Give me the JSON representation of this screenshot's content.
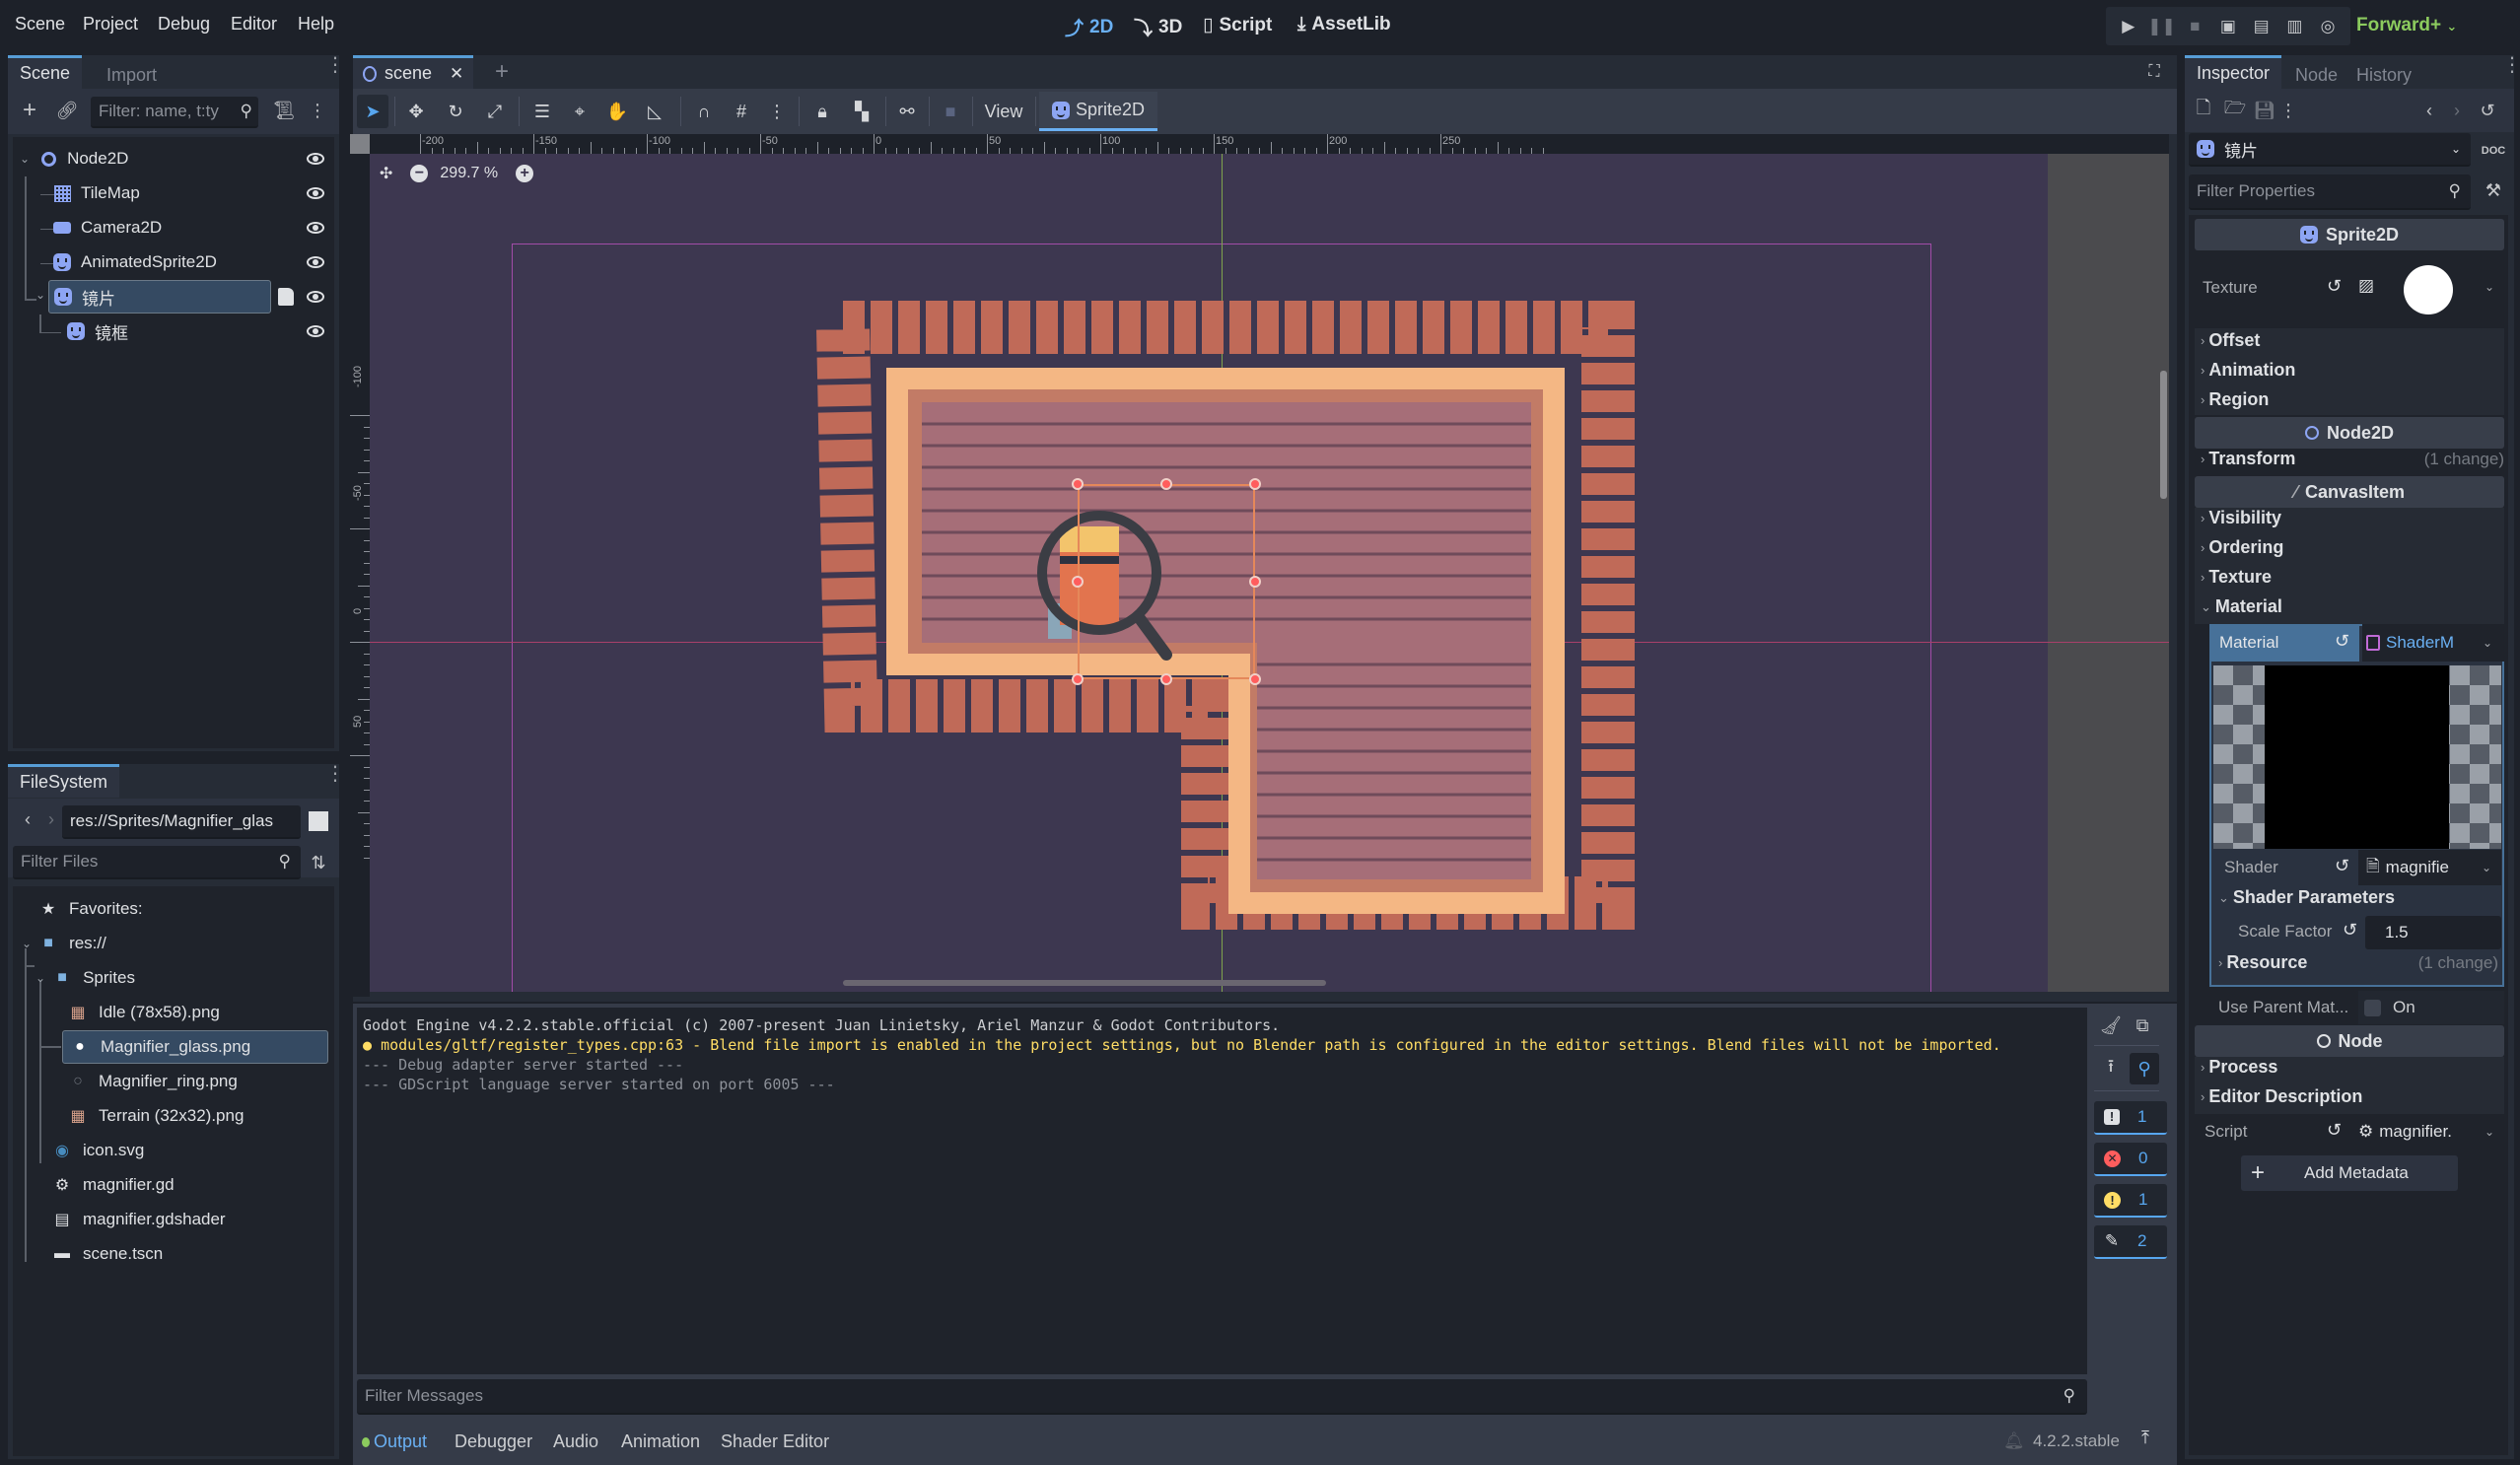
{
  "menu": [
    "Scene",
    "Project",
    "Debug",
    "Editor",
    "Help"
  ],
  "workspaces": [
    {
      "label": "2D",
      "icon": "2d-icon",
      "active": true
    },
    {
      "label": "3D",
      "icon": "3d-icon",
      "active": false
    },
    {
      "label": "Script",
      "icon": "script-icon",
      "active": false
    },
    {
      "label": "AssetLib",
      "icon": "assetlib-icon",
      "active": false
    }
  ],
  "run_bar": [
    "play-icon",
    "pause-icon",
    "stop-icon",
    "remote-debug-icon",
    "play-scene-icon",
    "play-custom-scene-icon",
    "movie-maker-icon"
  ],
  "renderer": "Forward+",
  "scene_dock": {
    "tabs": [
      "Scene",
      "Import"
    ],
    "filter_placeholder": "Filter: name, t:ty",
    "nodes": [
      {
        "name": "Node2D",
        "type": "Node2D",
        "depth": 0
      },
      {
        "name": "TileMap",
        "type": "TileMap",
        "depth": 1
      },
      {
        "name": "Camera2D",
        "type": "Camera2D",
        "depth": 1
      },
      {
        "name": "AnimatedSprite2D",
        "type": "AnimatedSprite2D",
        "depth": 1
      },
      {
        "name": "镜片",
        "type": "Sprite2D",
        "depth": 1,
        "selected": true,
        "has_script": true
      },
      {
        "name": "镜框",
        "type": "Sprite2D",
        "depth": 2
      }
    ]
  },
  "filesystem": {
    "tab": "FileSystem",
    "path": "res://Sprites/Magnifier_glas",
    "filter_placeholder": "Filter Files",
    "items": [
      {
        "label": "Favorites:",
        "icon": "star-icon"
      },
      {
        "label": "res://",
        "icon": "folder-icon"
      },
      {
        "label": "Sprites",
        "icon": "folder-icon"
      },
      {
        "label": "Idle (78x58).png",
        "icon": "image-icon"
      },
      {
        "label": "Magnifier_glass.png",
        "icon": "image-icon",
        "selected": true
      },
      {
        "label": "Magnifier_ring.png",
        "icon": "image-icon"
      },
      {
        "label": "Terrain (32x32).png",
        "icon": "image-icon"
      },
      {
        "label": "icon.svg",
        "icon": "godot-icon"
      },
      {
        "label": "magnifier.gd",
        "icon": "gear-icon"
      },
      {
        "label": "magnifier.gdshader",
        "icon": "shader-icon"
      },
      {
        "label": "scene.tscn",
        "icon": "clapper-icon"
      }
    ]
  },
  "editor_tabs": [
    {
      "label": "scene",
      "active": true
    }
  ],
  "viewport": {
    "view_menu": "View",
    "selected_type": "Sprite2D",
    "zoom": "299.7 %",
    "ruler_x": [
      "-200",
      "-150",
      "-100",
      "-50",
      "0",
      "50",
      "100",
      "150",
      "200",
      "250"
    ],
    "ruler_y": [
      "-100",
      "-50",
      "0",
      "50"
    ]
  },
  "output": {
    "lines": [
      {
        "text": "Godot Engine v4.2.2.stable.official (c) 2007-present Juan Linietsky, Ariel Manzur & Godot Contributors.",
        "kind": "normal"
      },
      {
        "text": "modules/gltf/register_types.cpp:63 - Blend file import is enabled in the project settings, but no Blender path is configured in the editor settings. Blend files will not be imported.",
        "kind": "warning"
      },
      {
        "text": "--- Debug adapter server started ---",
        "kind": "dim"
      },
      {
        "text": "--- GDScript language server started on port 6005 ---",
        "kind": "dim"
      }
    ],
    "filter_placeholder": "Filter Messages",
    "counters": {
      "messages": "1",
      "errors": "0",
      "warnings": "1",
      "editor": "2"
    }
  },
  "bottom_tabs": [
    "Output",
    "Debugger",
    "Audio",
    "Animation",
    "Shader Editor"
  ],
  "version": "4.2.2.stable",
  "inspector": {
    "tabs": [
      "Inspector",
      "Node",
      "History"
    ],
    "object_name": "镜片",
    "filter_placeholder": "Filter Properties",
    "class_sprite": "Sprite2D",
    "texture_label": "Texture",
    "groups_sprite": [
      "Offset",
      "Animation",
      "Region"
    ],
    "class_node2d": "Node2D",
    "transform": "Transform",
    "transform_change": "(1 change)",
    "class_canvas": "CanvasItem",
    "groups_canvas": [
      "Visibility",
      "Ordering",
      "Texture"
    ],
    "material_group": "Material",
    "material_label": "Material",
    "material_value": "ShaderM",
    "shader_label": "Shader",
    "shader_value": "magnifie",
    "shader_params": "Shader Parameters",
    "scale_factor_label": "Scale Factor",
    "scale_factor_value": "1.5",
    "resource": "Resource",
    "resource_change": "(1 change)",
    "use_parent_label": "Use Parent Mat...",
    "use_parent_value": "On",
    "class_node": "Node",
    "groups_node": [
      "Process",
      "Editor Description"
    ],
    "script_label": "Script",
    "script_value": "magnifier.",
    "add_metadata": "Add Metadata"
  }
}
